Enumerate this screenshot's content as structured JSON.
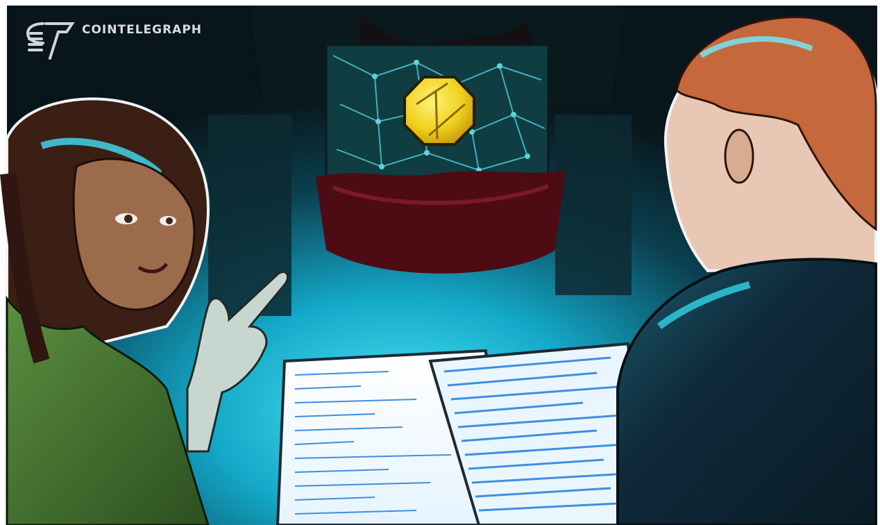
{
  "brand": {
    "name": "COINTELEGRAPH",
    "logo_icon": "cointelegraph-logo-icon"
  },
  "illustration": {
    "subject": "two-people-reviewing-code-on-laptops",
    "icons": [
      "crypto-coin-icon",
      "blockchain-network-icon",
      "pointing-hand-icon",
      "laptop-icon"
    ]
  },
  "colors": {
    "background_dark": "#0d1619",
    "glow_cyan": "#1ec7e6",
    "coin_gold": "#f1d21c",
    "velvet_red": "#5c0f18",
    "woman_shirt": "#3c6a2c",
    "man_shirt": "#0f2a3a",
    "man_hair": "#c5683b",
    "code_blue": "#3f8ee0"
  }
}
